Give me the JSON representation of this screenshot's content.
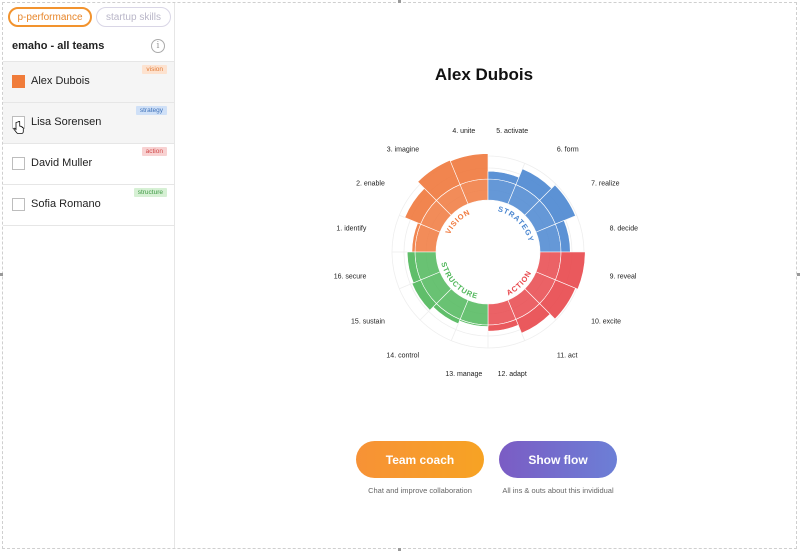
{
  "tabs": [
    {
      "label": "p-performance",
      "active": true
    },
    {
      "label": "startup skills",
      "active": false
    }
  ],
  "team_title": "emaho - all teams",
  "info_icon": "info-icon",
  "people": [
    {
      "name": "Alex Dubois",
      "badge": "vision",
      "badge_bg": "#fde2cf",
      "badge_fg": "#e07a36",
      "checked": true
    },
    {
      "name": "Lisa Sorensen",
      "badge": "strategy",
      "badge_bg": "#cfe0f7",
      "badge_fg": "#3c70b8",
      "checked": false
    },
    {
      "name": "David Muller",
      "badge": "action",
      "badge_bg": "#f8d2d2",
      "badge_fg": "#d04848",
      "checked": false
    },
    {
      "name": "Sofia Romano",
      "badge": "structure",
      "badge_bg": "#d6f0d4",
      "badge_fg": "#3f9a45",
      "checked": false
    }
  ],
  "main": {
    "title": "Alex Dubois"
  },
  "chart_data": {
    "type": "radial-bar",
    "segments": [
      {
        "label": "1. identify",
        "value": 0.1,
        "group": "vision"
      },
      {
        "label": "2. enable",
        "value": 0.55,
        "group": "vision"
      },
      {
        "label": "3. imagine",
        "value": 0.85,
        "group": "vision"
      },
      {
        "label": "4. unite",
        "value": 0.82,
        "group": "vision"
      },
      {
        "label": "5. activate",
        "value": 0.25,
        "group": "strategy"
      },
      {
        "label": "6. form",
        "value": 0.55,
        "group": "strategy"
      },
      {
        "label": "7. realize",
        "value": 0.7,
        "group": "strategy"
      },
      {
        "label": "8. decide",
        "value": 0.3,
        "group": "strategy"
      },
      {
        "label": "9. reveal",
        "value": 0.78,
        "group": "action"
      },
      {
        "label": "10. excite",
        "value": 0.7,
        "group": "action"
      },
      {
        "label": "11. act",
        "value": 0.48,
        "group": "action"
      },
      {
        "label": "12. adapt",
        "value": 0.2,
        "group": "action"
      },
      {
        "label": "13. manage",
        "value": 0.05,
        "group": "structure"
      },
      {
        "label": "14. control",
        "value": 0.15,
        "group": "structure"
      },
      {
        "label": "15. sustain",
        "value": 0.3,
        "group": "structure"
      },
      {
        "label": "16. secure",
        "value": 0.25,
        "group": "structure"
      }
    ],
    "groups": [
      {
        "name": "VISION",
        "color": "#f0783c"
      },
      {
        "name": "STRATEGY",
        "color": "#4a86d0"
      },
      {
        "name": "ACTION",
        "color": "#e8474b"
      },
      {
        "name": "STRUCTURE",
        "color": "#4fb75a"
      }
    ]
  },
  "buttons": {
    "coach": "Team coach",
    "coach_caption": "Chat and improve collaboration",
    "flow": "Show flow",
    "flow_caption": "All ins & outs about this invididual"
  }
}
